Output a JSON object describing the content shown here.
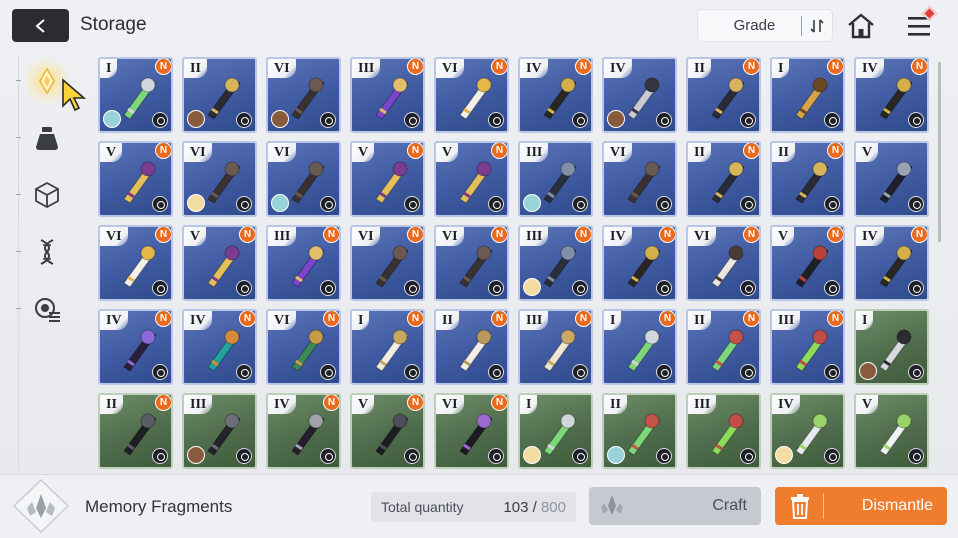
{
  "header": {
    "title": "Storage",
    "grade_button_label": "Grade",
    "back_icon": "back-arrow-icon",
    "home_icon": "home-icon",
    "menu_icon": "hamburger-menu-icon"
  },
  "sidebar": {
    "items": [
      {
        "name": "memory-fragment",
        "icon": "fragment-icon",
        "active": true
      },
      {
        "name": "pouch",
        "icon": "pouch-icon",
        "active": false
      },
      {
        "name": "cube",
        "icon": "cube-icon",
        "active": false
      },
      {
        "name": "gene",
        "icon": "dna-icon",
        "active": false
      },
      {
        "name": "list",
        "icon": "list-icon",
        "active": false
      }
    ]
  },
  "grid": {
    "rows": [
      [
        {
          "grade": "I",
          "bg": "blue",
          "new": true,
          "art": "vial",
          "avatar": "teal"
        },
        {
          "grade": "II",
          "bg": "blue",
          "new": false,
          "art": "staff",
          "avatar": "brown"
        },
        {
          "grade": "VI",
          "bg": "blue",
          "new": false,
          "art": "wing-dark",
          "avatar": "brown"
        },
        {
          "grade": "III",
          "bg": "blue",
          "new": true,
          "art": "gem",
          "avatar": "none"
        },
        {
          "grade": "VI",
          "bg": "blue",
          "new": true,
          "art": "wing-gold",
          "avatar": "none"
        },
        {
          "grade": "IV",
          "bg": "blue",
          "new": true,
          "art": "lantern",
          "avatar": "none"
        },
        {
          "grade": "IV",
          "bg": "blue",
          "new": false,
          "art": "chain",
          "avatar": "brown"
        },
        {
          "grade": "II",
          "bg": "blue",
          "new": true,
          "art": "staff",
          "avatar": "none"
        },
        {
          "grade": "I",
          "bg": "blue",
          "new": true,
          "art": "sword",
          "avatar": "none"
        },
        {
          "grade": "IV",
          "bg": "blue",
          "new": true,
          "art": "lantern",
          "avatar": "none"
        }
      ],
      [
        {
          "grade": "V",
          "bg": "blue",
          "new": true,
          "art": "chalice",
          "avatar": "none"
        },
        {
          "grade": "VI",
          "bg": "blue",
          "new": false,
          "art": "wing-dark",
          "avatar": "blond"
        },
        {
          "grade": "VI",
          "bg": "blue",
          "new": false,
          "art": "wing-dark",
          "avatar": "teal"
        },
        {
          "grade": "V",
          "bg": "blue",
          "new": true,
          "art": "chalice",
          "avatar": "none"
        },
        {
          "grade": "V",
          "bg": "blue",
          "new": true,
          "art": "chalice",
          "avatar": "none"
        },
        {
          "grade": "III",
          "bg": "blue",
          "new": false,
          "art": "orb",
          "avatar": "teal"
        },
        {
          "grade": "VI",
          "bg": "blue",
          "new": false,
          "art": "wing-dark",
          "avatar": "none"
        },
        {
          "grade": "II",
          "bg": "blue",
          "new": true,
          "art": "staff",
          "avatar": "none"
        },
        {
          "grade": "II",
          "bg": "blue",
          "new": true,
          "art": "staff",
          "avatar": "none"
        },
        {
          "grade": "V",
          "bg": "blue",
          "new": false,
          "art": "chalice-dark",
          "avatar": "none"
        }
      ],
      [
        {
          "grade": "VI",
          "bg": "blue",
          "new": true,
          "art": "wing-gold",
          "avatar": "none"
        },
        {
          "grade": "V",
          "bg": "blue",
          "new": true,
          "art": "chalice",
          "avatar": "none"
        },
        {
          "grade": "III",
          "bg": "blue",
          "new": true,
          "art": "gem",
          "avatar": "none"
        },
        {
          "grade": "VI",
          "bg": "blue",
          "new": true,
          "art": "wing-dark",
          "avatar": "none"
        },
        {
          "grade": "VI",
          "bg": "blue",
          "new": true,
          "art": "wing-dark",
          "avatar": "none"
        },
        {
          "grade": "III",
          "bg": "blue",
          "new": true,
          "art": "orb",
          "avatar": "blond"
        },
        {
          "grade": "IV",
          "bg": "blue",
          "new": true,
          "art": "lantern",
          "avatar": "none"
        },
        {
          "grade": "VI",
          "bg": "blue",
          "new": true,
          "art": "sickle",
          "avatar": "none"
        },
        {
          "grade": "V",
          "bg": "blue",
          "new": true,
          "art": "spider",
          "avatar": "none"
        },
        {
          "grade": "IV",
          "bg": "blue",
          "new": true,
          "art": "lantern",
          "avatar": "none"
        }
      ],
      [
        {
          "grade": "IV",
          "bg": "blue",
          "new": true,
          "art": "necklace-dark",
          "avatar": "none"
        },
        {
          "grade": "IV",
          "bg": "blue",
          "new": true,
          "art": "necklace-teal",
          "avatar": "none"
        },
        {
          "grade": "VI",
          "bg": "blue",
          "new": true,
          "art": "feather",
          "avatar": "none"
        },
        {
          "grade": "I",
          "bg": "blue",
          "new": true,
          "art": "crystal",
          "avatar": "none"
        },
        {
          "grade": "II",
          "bg": "blue",
          "new": true,
          "art": "crystal-small",
          "avatar": "none"
        },
        {
          "grade": "III",
          "bg": "blue",
          "new": true,
          "art": "shell",
          "avatar": "none"
        },
        {
          "grade": "I",
          "bg": "blue",
          "new": true,
          "art": "vial",
          "avatar": "none"
        },
        {
          "grade": "II",
          "bg": "blue",
          "new": true,
          "art": "syringe",
          "avatar": "none"
        },
        {
          "grade": "III",
          "bg": "blue",
          "new": true,
          "art": "flask-robot",
          "avatar": "none"
        },
        {
          "grade": "I",
          "bg": "green",
          "new": false,
          "art": "shuriken",
          "avatar": "brown"
        }
      ],
      [
        {
          "grade": "II",
          "bg": "green",
          "new": true,
          "art": "dark-spike",
          "avatar": "none"
        },
        {
          "grade": "III",
          "bg": "green",
          "new": false,
          "art": "dark-rose",
          "avatar": "brown"
        },
        {
          "grade": "IV",
          "bg": "green",
          "new": true,
          "art": "dark-necklace",
          "avatar": "none"
        },
        {
          "grade": "V",
          "bg": "green",
          "new": true,
          "art": "dark-leaf",
          "avatar": "none"
        },
        {
          "grade": "VI",
          "bg": "green",
          "new": true,
          "art": "dark-feather",
          "avatar": "none"
        },
        {
          "grade": "I",
          "bg": "green",
          "new": false,
          "art": "vial",
          "avatar": "blond"
        },
        {
          "grade": "II",
          "bg": "green",
          "new": false,
          "art": "syringe",
          "avatar": "teal"
        },
        {
          "grade": "III",
          "bg": "green",
          "new": false,
          "art": "flask-robot",
          "avatar": "none"
        },
        {
          "grade": "IV",
          "bg": "green",
          "new": false,
          "art": "tube-frame",
          "avatar": "blond"
        },
        {
          "grade": "V",
          "bg": "green",
          "new": false,
          "art": "cup",
          "avatar": "none"
        }
      ]
    ]
  },
  "footer": {
    "category_label": "Memory Fragments",
    "total_label": "Total quantity",
    "total_current": "103",
    "total_sep": " / ",
    "total_max": "800",
    "craft_label": "Craft",
    "dismantle_label": "Dismantle"
  },
  "colors": {
    "accent_orange": "#f07c2e",
    "tile_blue": "#4660a6",
    "tile_green": "#55734f",
    "new_badge": "#ea6a1d"
  },
  "new_badge_text": "N"
}
